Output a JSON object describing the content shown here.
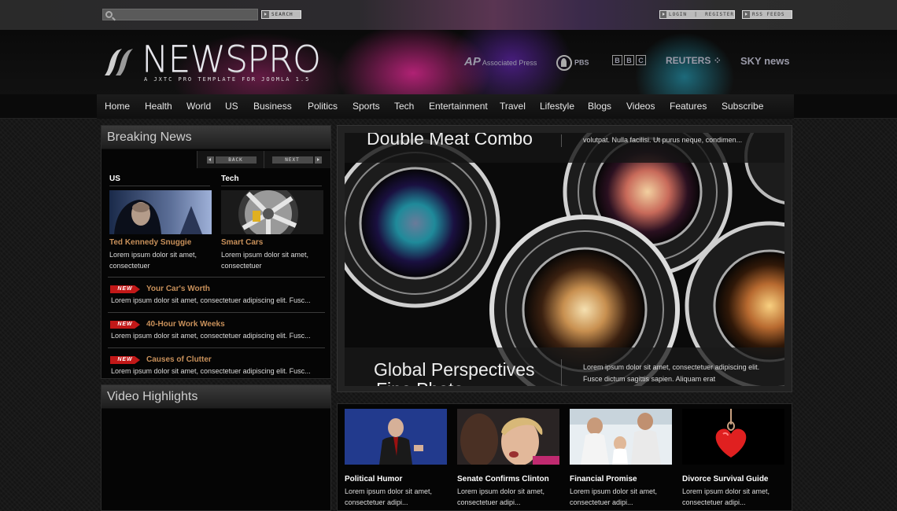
{
  "topbar": {
    "search_placeholder": "",
    "search_label": "SEARCH",
    "login_label": "LOGIN  |  REGISTER",
    "rss_label": "RSS FEEDS"
  },
  "header": {
    "logo_text": "NEWSPRO",
    "tagline": "A JXTC PRO TEMPLATE FOR JOOMLA 1.5",
    "partners": {
      "ap_mark": "AP",
      "ap_text": "Associated Press",
      "pbs": "PBS",
      "bbc": [
        "B",
        "B",
        "C"
      ],
      "reuters": "REUTERS",
      "sky": "SKY news"
    }
  },
  "nav": {
    "items": [
      "Home",
      "Health",
      "World",
      "US",
      "Business",
      "Politics",
      "Sports",
      "Tech",
      "Entertainment",
      "Travel",
      "Lifestyle",
      "Blogs",
      "Videos",
      "Features",
      "Subscribe"
    ]
  },
  "breaking": {
    "title": "Breaking News",
    "back": "BACK",
    "next": "NEXT",
    "featured": [
      {
        "category": "US",
        "headline": "Ted Kennedy Snuggie",
        "text": "Lorem ipsum dolor sit amet, consectetuer"
      },
      {
        "category": "Tech",
        "headline": "Smart Cars",
        "text": "Lorem ipsum dolor sit amet, consectetuer"
      }
    ],
    "badge": "NEW",
    "items": [
      {
        "headline": "Your Car's Worth",
        "text": "Lorem ipsum dolor sit amet, consectetuer adipiscing elit. Fusc..."
      },
      {
        "headline": "40-Hour Work Weeks",
        "text": "Lorem ipsum dolor sit amet, consectetuer adipiscing elit. Fusc..."
      },
      {
        "headline": "Causes of Clutter",
        "text": "Lorem ipsum dolor sit amet, consectetuer adipiscing elit. Fusc..."
      }
    ]
  },
  "video": {
    "title": "Video Highlights"
  },
  "slideshow": {
    "top_title": "Double Meat Combo",
    "top_desc": "volutpat. Nulla facilisi. Ut purus neque, condimen...",
    "bottom_title": "Global Perspectives",
    "bottom_title_line2": "Fine Photo...",
    "bottom_desc": "Lorem ipsum dolor sit amet, consectetuer adipiscing elit. Fusce dictum sagittis sapien. Aliquam erat"
  },
  "strip": [
    {
      "title": "Political Humor",
      "text": "Lorem ipsum dolor sit amet, consectetuer adipi..."
    },
    {
      "title": "Senate Confirms Clinton",
      "text": "Lorem ipsum dolor sit amet, consectetuer adipi..."
    },
    {
      "title": "Financial Promise",
      "text": "Lorem ipsum dolor sit amet, consectetuer adipi..."
    },
    {
      "title": "Divorce Survival Guide",
      "text": "Lorem ipsum dolor sit amet, consectetuer adipi..."
    }
  ],
  "colors": {
    "accent": "#c8905a",
    "badge": "#c21818",
    "brand_magenta": "#e0288f"
  }
}
